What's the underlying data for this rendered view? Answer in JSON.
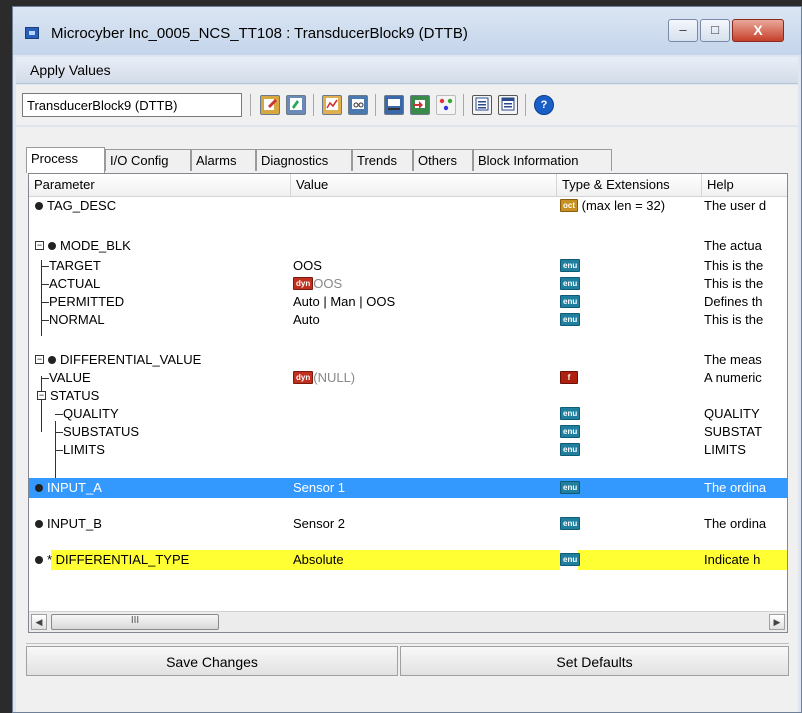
{
  "window": {
    "title": "Microcyber Inc_0005_NCS_TT108 : TransducerBlock9 (DTTB)",
    "min_glyph": "–",
    "max_glyph": "□",
    "close_glyph": "X"
  },
  "menu": {
    "apply_values": "Apply Values"
  },
  "toolbar": {
    "block_selector_value": "TransducerBlock9 (DTTB)"
  },
  "tabs": [
    {
      "label": "Process"
    },
    {
      "label": "I/O Config"
    },
    {
      "label": "Alarms"
    },
    {
      "label": "Diagnostics"
    },
    {
      "label": "Trends"
    },
    {
      "label": "Others"
    },
    {
      "label": "Block Information"
    }
  ],
  "grid": {
    "headers": {
      "parameter": "Parameter",
      "value": "Value",
      "type": "Type & Extensions",
      "help": "Help"
    },
    "rows": [
      {
        "param": "TAG_DESC",
        "value": "",
        "badge": "oct",
        "type_text": "(max len = 32)",
        "help": "The user d"
      },
      {
        "param": "MODE_BLK",
        "value": "",
        "badge": "",
        "type_text": "",
        "help": "The actua"
      },
      {
        "param": "TARGET",
        "value": "OOS",
        "badge": "enu",
        "type_text": "",
        "help": "This is the"
      },
      {
        "param": "ACTUAL",
        "value": "OOS",
        "value_badge": "dyn",
        "badge": "enu",
        "type_text": "",
        "help": "This is the"
      },
      {
        "param": "PERMITTED",
        "value": "Auto | Man | OOS",
        "badge": "enu",
        "type_text": "",
        "help": "Defines th"
      },
      {
        "param": "NORMAL",
        "value": "Auto",
        "badge": "enu",
        "type_text": "",
        "help": "This is the"
      },
      {
        "param": "DIFFERENTIAL_VALUE",
        "value": "",
        "badge": "",
        "type_text": "",
        "help": "The meas"
      },
      {
        "param": "VALUE",
        "value": "(NULL)",
        "value_badge": "dyn",
        "badge": "f",
        "type_text": "",
        "help": "A numeric"
      },
      {
        "param": "STATUS",
        "value": "",
        "badge": "",
        "type_text": "",
        "help": ""
      },
      {
        "param": "QUALITY",
        "value": "",
        "badge": "enu",
        "type_text": "",
        "help": "QUALITY"
      },
      {
        "param": "SUBSTATUS",
        "value": "",
        "badge": "enu",
        "type_text": "",
        "help": "SUBSTAT"
      },
      {
        "param": "LIMITS",
        "value": "",
        "badge": "enu",
        "type_text": "",
        "help": "LIMITS"
      },
      {
        "param": "INPUT_A",
        "value": "Sensor 1",
        "badge": "enu",
        "type_text": "",
        "help": "The ordina"
      },
      {
        "param": "INPUT_B",
        "value": "Sensor 2",
        "badge": "enu",
        "type_text": "",
        "help": "The ordina"
      },
      {
        "param": "* DIFFERENTIAL_TYPE",
        "value": "Absolute",
        "badge": "enu",
        "type_text": "",
        "help": "Indicate h"
      }
    ],
    "badge_labels": {
      "oct": "oct",
      "enu": "enu",
      "dyn": "dyn",
      "f": "f"
    },
    "scroll_thumb_glyph": "III"
  },
  "footer": {
    "save_changes": "Save Changes",
    "set_defaults": "Set Defaults"
  },
  "colors": {
    "selected_row": "#3399ff",
    "highlight_row": "#ffff33",
    "enu_badge": "#1f7f9f",
    "dyn_badge": "#c0301f",
    "oct_badge": "#c89020"
  }
}
